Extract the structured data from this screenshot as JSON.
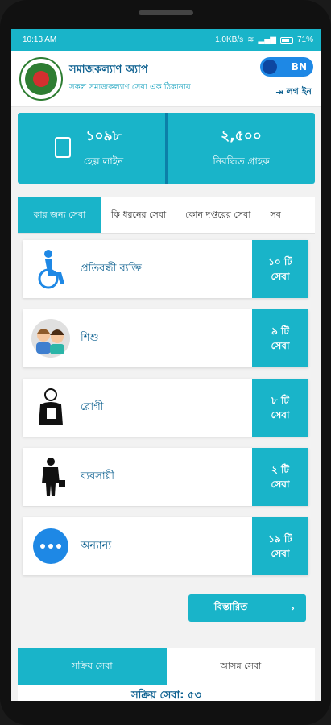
{
  "statusbar": {
    "time": "10:13 AM",
    "speed": "1.0KB/s",
    "battery": "71%"
  },
  "header": {
    "title": "সমাজকল্যাণ অ্যাপ",
    "subtitle": "সকল সমাজকল্যাণ সেবা এক ঠিকানায়",
    "lang": "BN",
    "login": "লগ ইন"
  },
  "stats": [
    {
      "value": "১০৯৮",
      "label": "হেল্প লাইন"
    },
    {
      "value": "২,৫০০",
      "label": "নিবন্ধিত গ্রাহক"
    }
  ],
  "tabs": [
    {
      "label": "কার জন্য সেবা"
    },
    {
      "label": "কি ধরনের সেবা"
    },
    {
      "label": "কোন দপ্তরের সেবা"
    },
    {
      "label": "সব"
    }
  ],
  "items": [
    {
      "name": "প্রতিবন্ধী ব্যক্তি",
      "count": "১০ টি",
      "unit": "সেবা",
      "icon": "wheelchair-icon"
    },
    {
      "name": "শিশু",
      "count": "৯ টি",
      "unit": "সেবা",
      "icon": "children-icon"
    },
    {
      "name": "রোগী",
      "count": "৮ টি",
      "unit": "সেবা",
      "icon": "patient-icon"
    },
    {
      "name": "ব্যবসায়ী",
      "count": "২ টি",
      "unit": "সেবা",
      "icon": "businessman-icon"
    },
    {
      "name": "অন্যান্য",
      "count": "১৯ টি",
      "unit": "সেবা",
      "icon": "more-icon"
    }
  ],
  "more_button": "বিস্তারিত",
  "bottom_tabs": [
    {
      "label": "সক্রিয় সেবা"
    },
    {
      "label": "আসন্ন সেবা"
    }
  ],
  "bottom_heading": "সক্রিয় সেবা: ৫৩"
}
